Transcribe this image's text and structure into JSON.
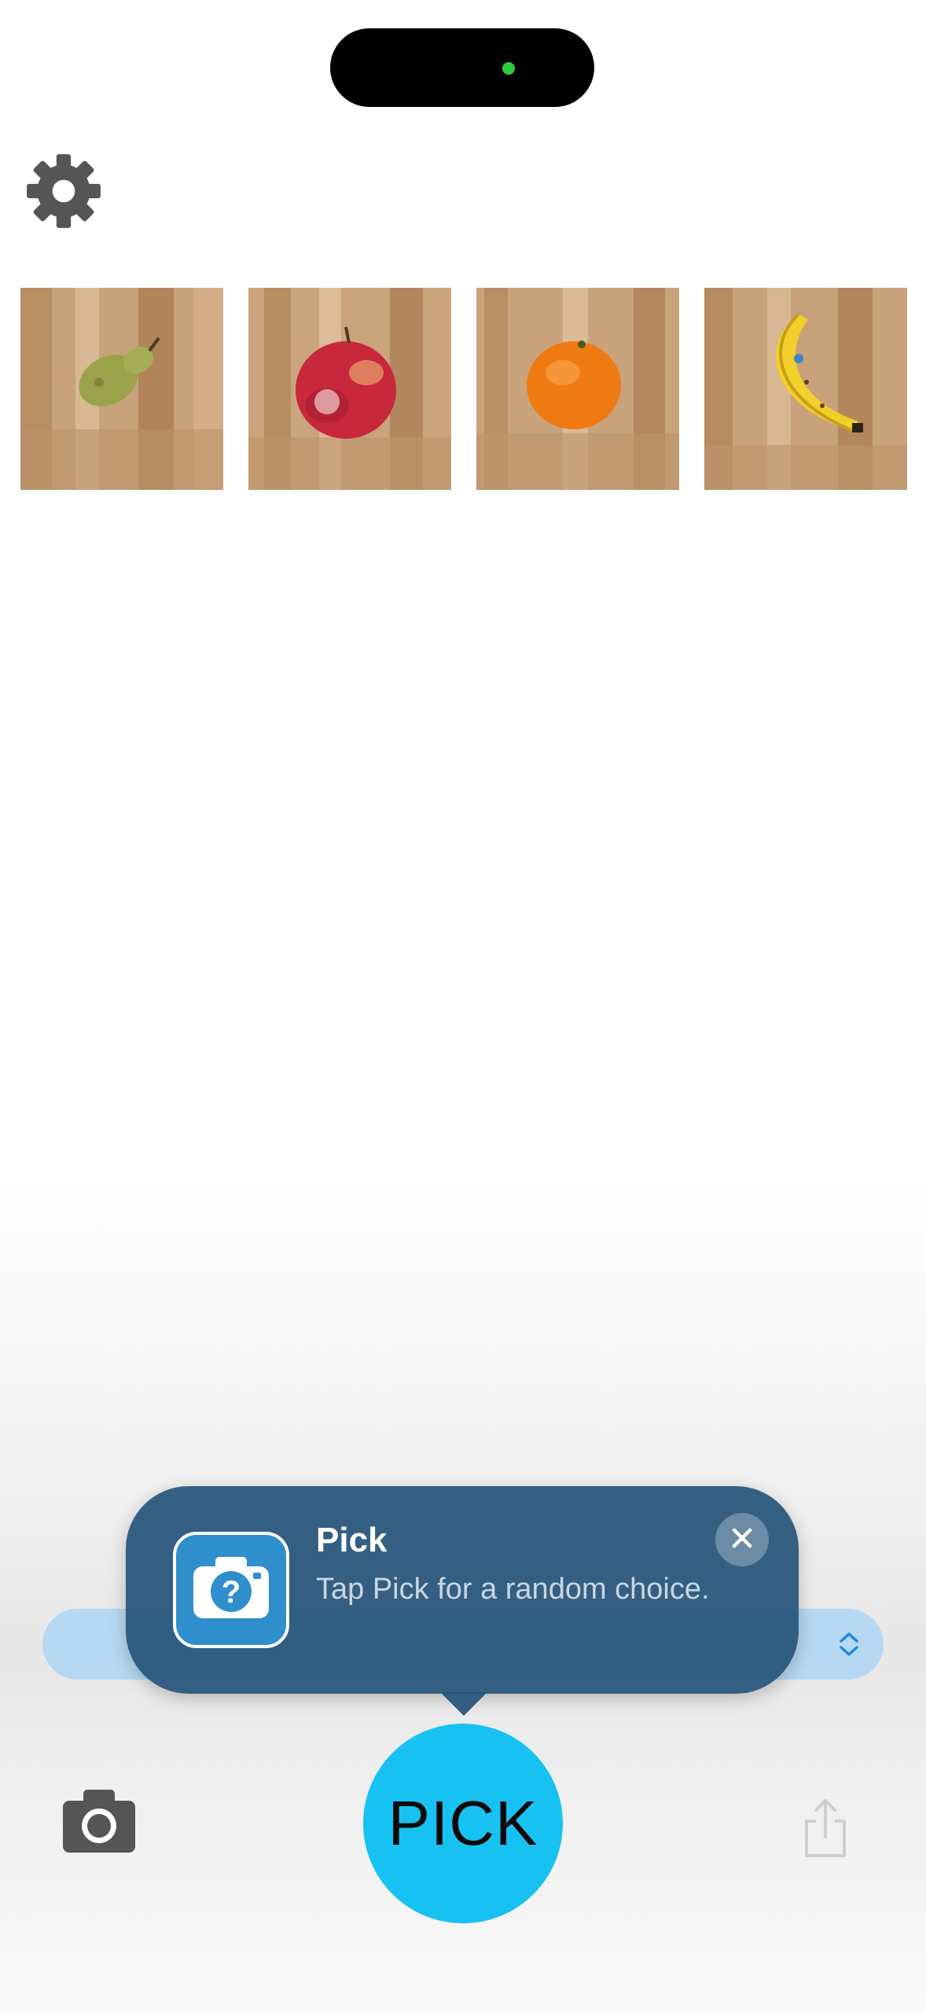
{
  "toolbar": {
    "settings_icon": "gear-icon"
  },
  "photos": [
    {
      "name": "pear",
      "accent": "#9aa34a"
    },
    {
      "name": "apple",
      "accent": "#c8283c"
    },
    {
      "name": "orange",
      "accent": "#f07a12"
    },
    {
      "name": "banana",
      "accent": "#f2cf2a"
    }
  ],
  "tip": {
    "title": "Pick",
    "message": "Tap Pick for a random choice.",
    "icon": "camera-question-icon",
    "close_icon": "close-icon",
    "close_glyph": "✕"
  },
  "bottom": {
    "pick_label": "PICK",
    "camera_icon": "camera-icon",
    "share_icon": "share-icon"
  },
  "colors": {
    "accent": "#17c2f2",
    "tip_background": "#26547a",
    "bar_background": "#b6d8f2"
  }
}
